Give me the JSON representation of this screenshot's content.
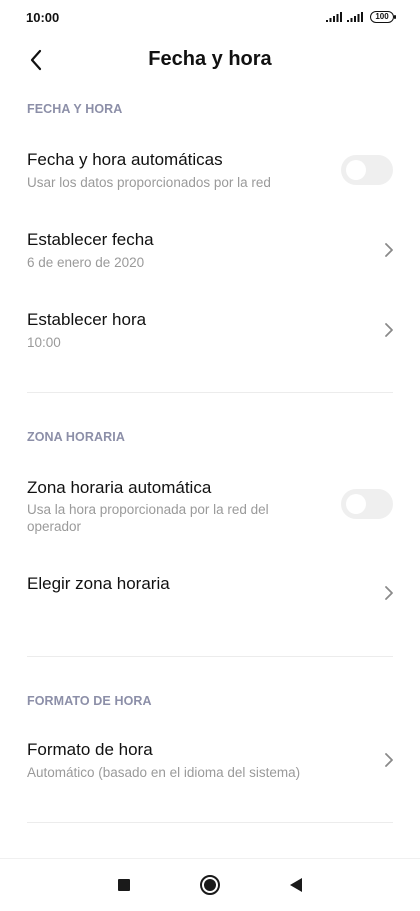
{
  "status_bar": {
    "time": "10:00",
    "battery": "100"
  },
  "header": {
    "title": "Fecha y hora"
  },
  "sections": {
    "date_time": {
      "header": "FECHA Y HORA",
      "auto_datetime": {
        "title": "Fecha y hora automáticas",
        "summary": "Usar los datos proporcionados por la red",
        "enabled": false
      },
      "set_date": {
        "title": "Establecer fecha",
        "summary": "6 de enero de 2020"
      },
      "set_time": {
        "title": "Establecer hora",
        "summary": "10:00"
      }
    },
    "time_zone": {
      "header": "ZONA HORARIA",
      "auto_zone": {
        "title": "Zona horaria automática",
        "summary": "Usa la hora proporcionada por la red del operador",
        "enabled": false
      },
      "choose_zone": {
        "title": "Elegir zona horaria"
      }
    },
    "time_format": {
      "header": "FORMATO DE HORA",
      "format": {
        "title": "Formato de hora",
        "summary": "Automático (basado en el idioma del sistema)"
      }
    }
  },
  "icons": {
    "back": "chevron-left-icon",
    "chevron": "chevron-right-icon",
    "nav_recents": "square-icon",
    "nav_home": "circle-icon",
    "nav_back": "triangle-back-icon"
  },
  "colors": {
    "section_header": "#8c8fa8",
    "summary_text": "#9a9a9a",
    "toggle_off": "#efefef"
  }
}
